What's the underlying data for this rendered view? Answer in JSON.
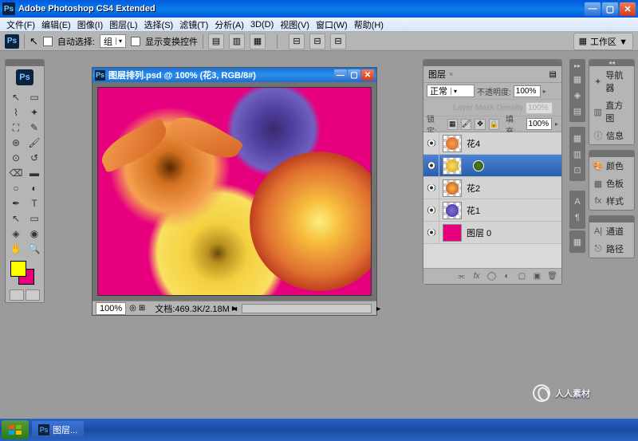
{
  "app": {
    "title": "Adobe Photoshop CS4 Extended",
    "ps_badge": "Ps"
  },
  "menubar": [
    "文件(F)",
    "编辑(E)",
    "图像(I)",
    "图层(L)",
    "选择(S)",
    "滤镜(T)",
    "分析(A)",
    "3D(D)",
    "视图(V)",
    "窗口(W)",
    "帮助(H)"
  ],
  "optbar": {
    "auto_select": "自动选择:",
    "group": "组",
    "show_transform": "显示变换控件",
    "workspace": "工作区 ▼"
  },
  "doc": {
    "title": "图层排列.psd @ 100% (花3, RGB/8#)",
    "zoom": "100%",
    "status": "文档:469.3K/2.18M"
  },
  "layers": {
    "tab": "图层",
    "blend_mode": "正常",
    "opacity_label": "不透明度:",
    "opacity_value": "100%",
    "mask_label": "Layer Mask Density",
    "mask_value": "100%",
    "lock_label": "锁定:",
    "fill_label": "填充:",
    "fill_value": "100%",
    "items": [
      {
        "name": "花4",
        "thumb_color": "#f4a050"
      },
      {
        "name": "",
        "thumb_color": "#f4d040",
        "selected": true
      },
      {
        "name": "花2",
        "thumb_color": "#d47040"
      },
      {
        "name": "花1",
        "thumb_color": "#7060c0"
      },
      {
        "name": "图层 0",
        "thumb_color": "#e6007e",
        "solid": true
      }
    ]
  },
  "right_panels": {
    "group1": [
      {
        "icon": "✦",
        "label": "导航器"
      },
      {
        "icon": "▥",
        "label": "直方图"
      },
      {
        "icon": "ⓘ",
        "label": "信息"
      }
    ],
    "group2": [
      {
        "icon": "🎨",
        "label": "颜色"
      },
      {
        "icon": "▦",
        "label": "色板"
      },
      {
        "icon": "fx",
        "label": "样式"
      }
    ],
    "group3": [
      {
        "icon": "A|",
        "label": "通道"
      },
      {
        "icon": "⎋",
        "label": "路径"
      }
    ]
  },
  "taskbar": {
    "item": "图层..."
  },
  "watermark": "人人素材"
}
